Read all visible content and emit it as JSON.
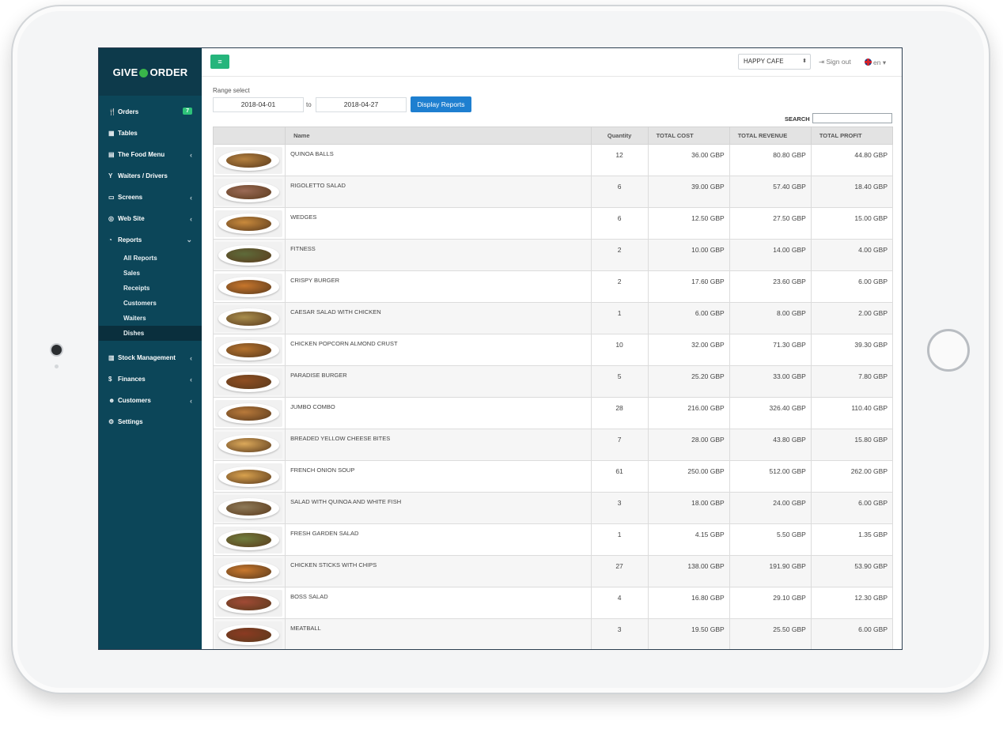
{
  "sidebar": {
    "brand": {
      "left": "GIVE",
      "right": "ORDER"
    },
    "items": [
      {
        "label": "Orders",
        "icon": "utensils-icon",
        "glyph": "🍴",
        "badge": "7"
      },
      {
        "label": "Tables",
        "icon": "grid-icon",
        "glyph": "▦"
      },
      {
        "label": "The Food Menu",
        "icon": "document-icon",
        "glyph": "▤",
        "chevron": "‹"
      },
      {
        "label": "Waiters / Drivers",
        "icon": "cocktail-icon",
        "glyph": "Y"
      },
      {
        "label": "Screens",
        "icon": "monitor-icon",
        "glyph": "▭",
        "chevron": "‹"
      },
      {
        "label": "Web Site",
        "icon": "globe-icon",
        "glyph": "◎",
        "chevron": "‹"
      },
      {
        "label": "Reports",
        "icon": "pie-chart-icon",
        "glyph": "◔",
        "chevron": "⌄"
      }
    ],
    "report_subitems": [
      "All Reports",
      "Sales",
      "Receipts",
      "Customers",
      "Waiters",
      "Dishes"
    ],
    "items_after": [
      {
        "label": "Stock Management",
        "icon": "bar-chart-icon",
        "glyph": "▥",
        "chevron": "‹"
      },
      {
        "label": "Finances",
        "icon": "dollar-icon",
        "glyph": "$",
        "chevron": "‹"
      },
      {
        "label": "Customers",
        "icon": "users-icon",
        "glyph": "☻",
        "chevron": "‹"
      },
      {
        "label": "Settings",
        "icon": "gear-icon",
        "glyph": "⚙"
      }
    ]
  },
  "topbar": {
    "menu_glyph": "≡",
    "cafe": "HAPPY CAFE",
    "select_glyph": "⬍",
    "signout": "Sign out",
    "signout_glyph": "⇥",
    "lang": "en",
    "lang_glyph": "▾"
  },
  "filters": {
    "range_label": "Range select",
    "from": "2018-04-01",
    "to_label": "to",
    "to": "2018-04-27",
    "display_button": "Display Reports",
    "search_label": "SEARCH"
  },
  "table": {
    "headers": [
      "",
      "Name",
      "Quantity",
      "TOTAL COST",
      "TOTAL REVENUE",
      "TOTAL PROFIT"
    ],
    "rows": [
      {
        "name": "QUINOA BALLS",
        "qty": "12",
        "cost": "36.00 GBP",
        "revenue": "80.80 GBP",
        "profit": "44.80 GBP",
        "color": "#b5813f"
      },
      {
        "name": "RIGOLETTO SALAD",
        "qty": "6",
        "cost": "39.00 GBP",
        "revenue": "57.40 GBP",
        "profit": "18.40 GBP",
        "color": "#9b6a55"
      },
      {
        "name": "WEDGES",
        "qty": "6",
        "cost": "12.50 GBP",
        "revenue": "27.50 GBP",
        "profit": "15.00 GBP",
        "color": "#c98a3c"
      },
      {
        "name": "FITNESS",
        "qty": "2",
        "cost": "10.00 GBP",
        "revenue": "14.00 GBP",
        "profit": "4.00 GBP",
        "color": "#5e6b3a"
      },
      {
        "name": "CRISPY BURGER",
        "qty": "2",
        "cost": "17.60 GBP",
        "revenue": "23.60 GBP",
        "profit": "6.00 GBP",
        "color": "#c7762c"
      },
      {
        "name": "CAESAR SALAD WITH CHICKEN",
        "qty": "1",
        "cost": "6.00 GBP",
        "revenue": "8.00 GBP",
        "profit": "2.00 GBP",
        "color": "#a88d4c"
      },
      {
        "name": "CHICKEN POPCORN ALMOND CRUST",
        "qty": "10",
        "cost": "32.00 GBP",
        "revenue": "71.30 GBP",
        "profit": "39.30 GBP",
        "color": "#b4722e"
      },
      {
        "name": "PARADISE BURGER",
        "qty": "5",
        "cost": "25.20 GBP",
        "revenue": "33.00 GBP",
        "profit": "7.80 GBP",
        "color": "#8f4e22"
      },
      {
        "name": "JUMBO COMBO",
        "qty": "28",
        "cost": "216.00 GBP",
        "revenue": "326.40 GBP",
        "profit": "110.40 GBP",
        "color": "#b8793a"
      },
      {
        "name": "BREADED YELLOW CHEESE BITES",
        "qty": "7",
        "cost": "28.00 GBP",
        "revenue": "43.80 GBP",
        "profit": "15.80 GBP",
        "color": "#dca95a"
      },
      {
        "name": "FRENCH ONION SOUP",
        "qty": "61",
        "cost": "250.00 GBP",
        "revenue": "512.00 GBP",
        "profit": "262.00 GBP",
        "color": "#d9a24e"
      },
      {
        "name": "SALAD WITH QUINOA AND WHITE FISH",
        "qty": "3",
        "cost": "18.00 GBP",
        "revenue": "24.00 GBP",
        "profit": "6.00 GBP",
        "color": "#8e7a58"
      },
      {
        "name": "FRESH GARDEN SALAD",
        "qty": "1",
        "cost": "4.15 GBP",
        "revenue": "5.50 GBP",
        "profit": "1.35 GBP",
        "color": "#6f7d3d"
      },
      {
        "name": "CHICKEN STICKS WITH CHIPS",
        "qty": "27",
        "cost": "138.00 GBP",
        "revenue": "191.90 GBP",
        "profit": "53.90 GBP",
        "color": "#c9782d"
      },
      {
        "name": "BOSS SALAD",
        "qty": "4",
        "cost": "16.80 GBP",
        "revenue": "29.10 GBP",
        "profit": "12.30 GBP",
        "color": "#a04a35"
      },
      {
        "name": "MEATBALL",
        "qty": "3",
        "cost": "19.50 GBP",
        "revenue": "25.50 GBP",
        "profit": "6.00 GBP",
        "color": "#8b3a22"
      }
    ]
  }
}
